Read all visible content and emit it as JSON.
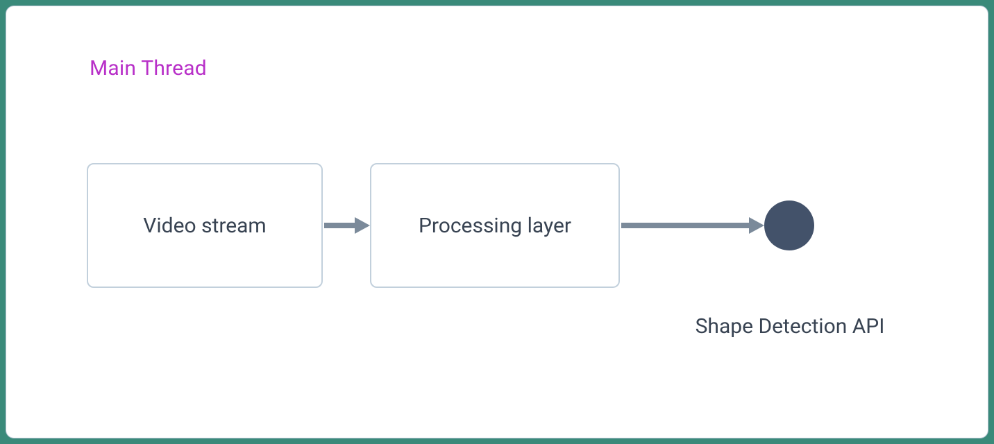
{
  "diagram": {
    "title": "Main Thread",
    "nodes": {
      "video_stream": {
        "label": "Video stream",
        "type": "box"
      },
      "processing_layer": {
        "label": "Processing layer",
        "type": "box"
      },
      "shape_detection_api": {
        "label": "Shape Detection API",
        "type": "circle"
      }
    },
    "edges": [
      {
        "from": "video_stream",
        "to": "processing_layer"
      },
      {
        "from": "processing_layer",
        "to": "shape_detection_api"
      }
    ],
    "colors": {
      "title": "#b830c8",
      "box_border": "#c2d0dc",
      "text": "#384352",
      "arrow": "#7b8a9a",
      "node_fill": "#43526a",
      "canvas_border": "#b4c3d1",
      "canvas_bg": "#ffffff",
      "page_bg": "#3a8a7a"
    }
  }
}
